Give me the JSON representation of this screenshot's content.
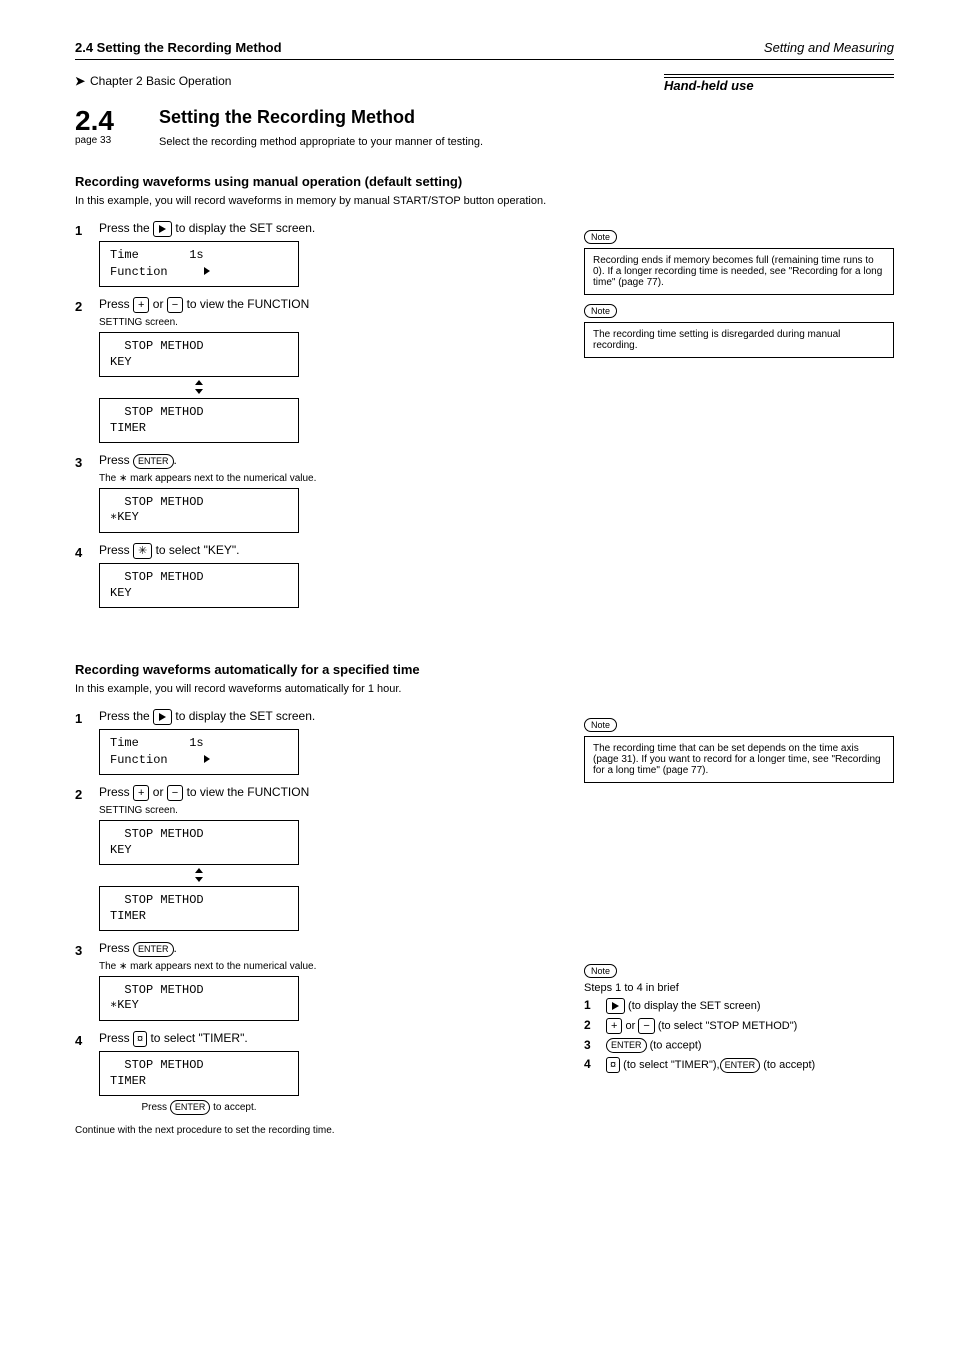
{
  "header": {
    "left": "2.4 Setting the Recording Method",
    "right_italic": "Setting and Measuring"
  },
  "subhead": {
    "arrow": "➤",
    "left": "Chapter 2 Basic Operation",
    "right_italic": "Hand-held use"
  },
  "page_heading_right": "Setting the Recording Method",
  "page_number_block": {
    "num": "2.4",
    "page": "33"
  },
  "intro": "Select the recording method appropriate to your manner of testing.",
  "sectionA": {
    "title": "Recording waveforms using manual operation (default setting)",
    "sub": "In this example, you will record waveforms in memory by manual START/STOP button operation.",
    "steps": [
      {
        "n": "1",
        "line1": [
          "Press the ",
          "PLAY_BTN",
          " to display the SET screen."
        ],
        "display": "Time       1s\nFunction     ►"
      },
      {
        "n": "2",
        "line1": [
          "Press ",
          "PLUS_BTN",
          " or ",
          "MINUS_BTN",
          " to view the FUNCTION"
        ],
        "line2_small": "SETTING screen.",
        "display_stack": [
          "  STOP METHOD\nKEY",
          "  STOP METHOD\nTIMER"
        ]
      },
      {
        "n": "3",
        "line1": [
          "Press ",
          "ENTER_BTN",
          "."
        ],
        "line2_small": "The ∗ mark appears next to the numerical value.",
        "display": "  STOP METHOD\n∗KEY"
      },
      {
        "n": "4",
        "line1": [
          "Press ",
          "STAR_BTN",
          " to select \"KEY\"."
        ],
        "display": "  STOP METHOD\nKEY"
      }
    ],
    "notes": [
      {
        "label": "Note",
        "text": "Recording ends if memory becomes full (remaining time runs to 0). If a longer recording time is needed, see \"Recording for a long time\" (page 77)."
      },
      {
        "label": "Note",
        "text": "The recording time setting is disregarded during manual recording."
      }
    ]
  },
  "sectionB": {
    "title": "Recording waveforms automatically for a specified time",
    "sub": "In this example, you will record waveforms automatically for 1 hour.",
    "steps": [
      {
        "n": "1",
        "line1": [
          "Press the ",
          "PLAY_BTN",
          " to display the SET screen."
        ],
        "display": "Time       1s\nFunction     ►"
      },
      {
        "n": "2",
        "line1": [
          "Press ",
          "PLUS_BTN",
          " or ",
          "MINUS_BTN",
          " to view the FUNCTION"
        ],
        "line2_small": "SETTING screen.",
        "display_stack": [
          "  STOP METHOD\nKEY",
          "  STOP METHOD\nTIMER"
        ]
      },
      {
        "n": "3",
        "line1": [
          "Press ",
          "ENTER_BTN",
          "."
        ],
        "line2_small": "The ∗ mark appears next to the numerical value.",
        "display": "  STOP METHOD\n∗KEY"
      },
      {
        "n": "4",
        "line1": [
          "Press ",
          "CURR_BTN",
          " to select \"TIMER\"."
        ],
        "display": "  STOP METHOD\nTIMER",
        "after_small_raw": [
          "Press ",
          "ENTER_BTN",
          " to accept."
        ]
      }
    ],
    "notes": [
      {
        "label": "Note",
        "text": "The recording time that can be set depends on the time axis (page 31). If you want to record for a longer time, see \"Recording for a long time\" (page 77)."
      }
    ],
    "short": {
      "label": "Note",
      "intro": "Steps 1 to 4 in brief",
      "rows": [
        {
          "n": "1",
          "tokens": [
            "PLAY_BTN",
            " (to display the SET screen)"
          ]
        },
        {
          "n": "2",
          "tokens": [
            "PLUS_BTN",
            " or ",
            "MINUS_BTN",
            " (to select \"STOP METHOD\")"
          ]
        },
        {
          "n": "3",
          "tokens": [
            "ENTER_BTN",
            " (to accept)"
          ]
        },
        {
          "n": "4",
          "tokens": [
            "CURR_BTN",
            " (to select \"TIMER\"),",
            "ENTER_BTN",
            " (to accept)"
          ]
        }
      ]
    },
    "tail_small": "Continue with the next procedure to set the recording time."
  },
  "btn_labels": {
    "enter": "ENTER",
    "note": "Note"
  }
}
